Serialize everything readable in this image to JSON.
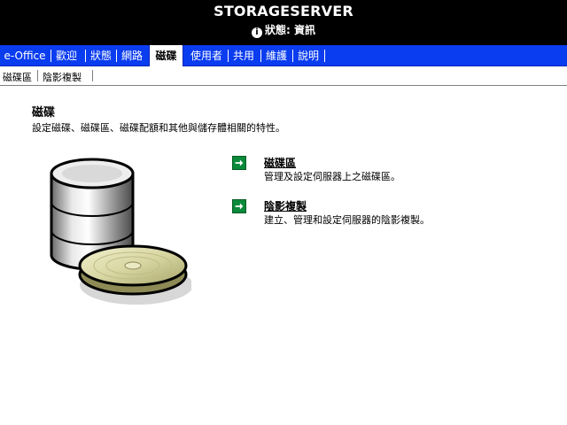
{
  "header": {
    "server_name": "STORAGESERVER",
    "status_label": "狀態:",
    "status_value": "資訊",
    "status_icon": "info-icon"
  },
  "tabs": [
    {
      "label": "e-Office"
    },
    {
      "label": "歡迎"
    },
    {
      "label": "狀態"
    },
    {
      "label": "網路"
    },
    {
      "label": "磁碟",
      "active": true
    },
    {
      "label": "使用者"
    },
    {
      "label": "共用"
    },
    {
      "label": "維護"
    },
    {
      "label": "說明"
    }
  ],
  "subnav": [
    {
      "label": "磁碟區"
    },
    {
      "label": "陰影複製"
    }
  ],
  "page": {
    "title": "磁碟",
    "description": "設定磁碟、磁碟區、磁碟配額和其他與儲存體相關的特性。"
  },
  "links": [
    {
      "title": "磁碟區",
      "description": "管理及設定伺服器上之磁碟區。",
      "icon": "green-arrow-icon"
    },
    {
      "title": "陰影複製",
      "description": "建立、管理和設定伺服器的陰影複製。",
      "icon": "green-arrow-icon"
    }
  ],
  "colors": {
    "tabbar": "#0a3cf0",
    "header": "#000000",
    "arrow_icon": "#0b8a3a"
  }
}
